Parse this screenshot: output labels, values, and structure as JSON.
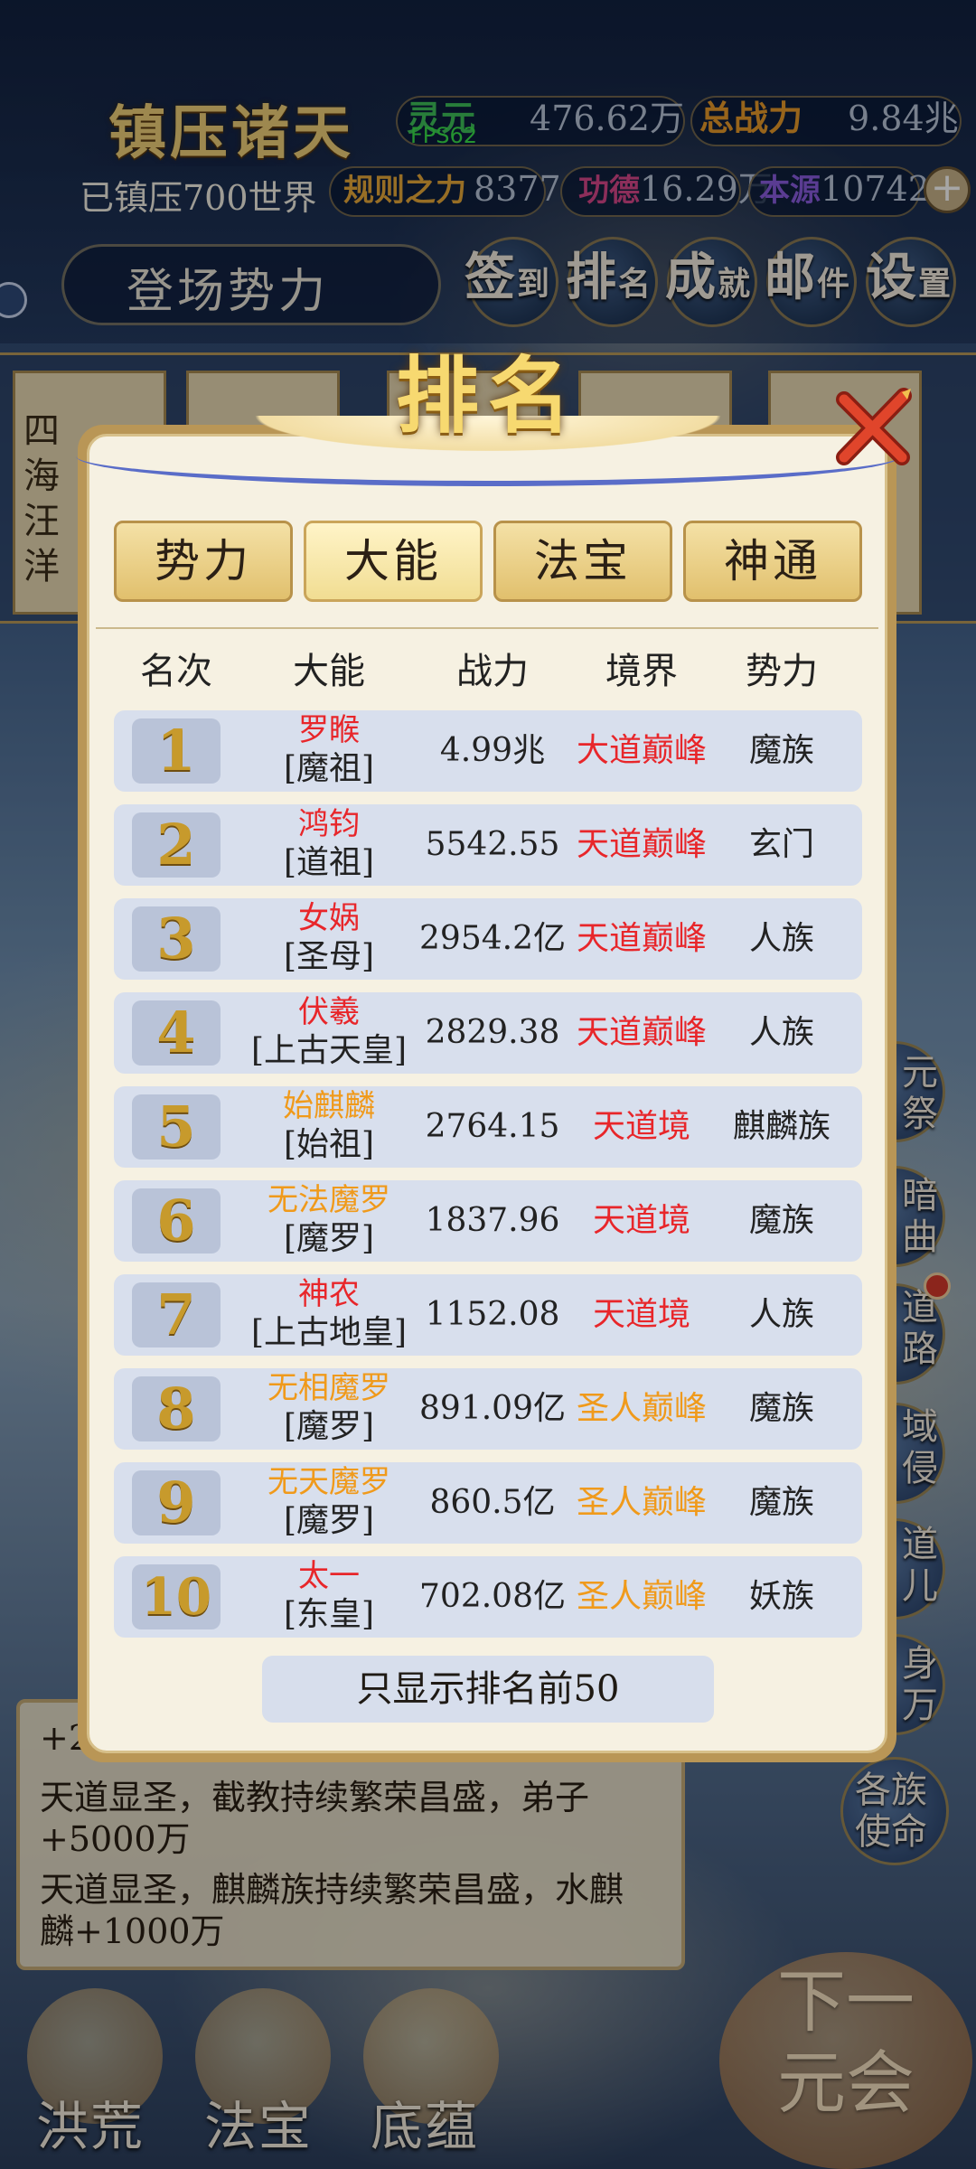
{
  "hud": {
    "game_title": "镇压诸天",
    "suppressed": "已镇压700世界",
    "fps": "FPS62",
    "stats": {
      "spirit_label": "灵元",
      "spirit_value": "476.62万",
      "power_label": "总战力",
      "power_value": "9.84兆",
      "rule_label": "规则之力",
      "rule_value": "8377",
      "merit_label": "功德",
      "merit_value": "16.29万",
      "origin_label": "本源",
      "origin_value": "107424"
    },
    "faction_button": "登场势力",
    "top_buttons": [
      {
        "big": "签",
        "small": "到"
      },
      {
        "big": "排",
        "small": "名"
      },
      {
        "big": "成",
        "small": "就"
      },
      {
        "big": "邮",
        "small": "件"
      },
      {
        "big": "设",
        "small": "置"
      }
    ],
    "strip_text": "四海汪洋",
    "side_buttons": [
      "元祭",
      "暗曲",
      "道路",
      "域侵",
      "道儿",
      "身万",
      "各族使命"
    ],
    "log_lines": [
      "+20",
      "天道显圣，截教持续繁荣昌盛，弟子+5000万",
      "天道显圣，麒麟族持续繁荣昌盛，水麒麟+1000万"
    ],
    "bottom_buttons": [
      "洪荒",
      "法宝",
      "底蕴"
    ],
    "next_round": "下一元会"
  },
  "modal": {
    "title": "排名",
    "tabs": [
      {
        "label": "势力",
        "active": false
      },
      {
        "label": "大能",
        "active": true
      },
      {
        "label": "法宝",
        "active": false
      },
      {
        "label": "神通",
        "active": false
      }
    ],
    "columns": [
      "名次",
      "大能",
      "战力",
      "境界",
      "势力"
    ],
    "rows": [
      {
        "rank": "1",
        "name": "罗睺",
        "name_color": "red",
        "title": "[魔祖]",
        "power": "4.99兆",
        "realm": "大道巅峰",
        "realm_color": "red",
        "faction": "魔族"
      },
      {
        "rank": "2",
        "name": "鸿钧",
        "name_color": "red",
        "title": "[道祖]",
        "power": "5542.55亿",
        "realm": "天道巅峰",
        "realm_color": "red",
        "faction": "玄门"
      },
      {
        "rank": "3",
        "name": "女娲",
        "name_color": "red",
        "title": "[圣母]",
        "power": "2954.2亿",
        "realm": "天道巅峰",
        "realm_color": "red",
        "faction": "人族"
      },
      {
        "rank": "4",
        "name": "伏羲",
        "name_color": "red",
        "title": "[上古天皇]",
        "power": "2829.38亿",
        "realm": "天道巅峰",
        "realm_color": "red",
        "faction": "人族"
      },
      {
        "rank": "5",
        "name": "始麒麟",
        "name_color": "orange",
        "title": "[始祖]",
        "power": "2764.15亿",
        "realm": "天道境",
        "realm_color": "red",
        "faction": "麒麟族"
      },
      {
        "rank": "6",
        "name": "无法魔罗",
        "name_color": "orange",
        "title": "[魔罗]",
        "power": "1837.96亿",
        "realm": "天道境",
        "realm_color": "red",
        "faction": "魔族"
      },
      {
        "rank": "7",
        "name": "神农",
        "name_color": "red",
        "title": "[上古地皇]",
        "power": "1152.08亿",
        "realm": "天道境",
        "realm_color": "red",
        "faction": "人族"
      },
      {
        "rank": "8",
        "name": "无相魔罗",
        "name_color": "orange",
        "title": "[魔罗]",
        "power": "891.09亿",
        "realm": "圣人巅峰",
        "realm_color": "orange",
        "faction": "魔族"
      },
      {
        "rank": "9",
        "name": "无天魔罗",
        "name_color": "orange",
        "title": "[魔罗]",
        "power": "860.5亿",
        "realm": "圣人巅峰",
        "realm_color": "orange",
        "faction": "魔族"
      },
      {
        "rank": "10",
        "name": "太一",
        "name_color": "red",
        "title": "[东皇]",
        "power": "702.08亿",
        "realm": "圣人巅峰",
        "realm_color": "orange",
        "faction": "妖族"
      }
    ],
    "footer_note": "只显示排名前50"
  },
  "colors": {
    "red": "#e8262a",
    "orange": "#f09a1b",
    "gold": "#f7d970",
    "row_bg": "#d8dfed",
    "modal_bg": "#f6f1e2"
  }
}
